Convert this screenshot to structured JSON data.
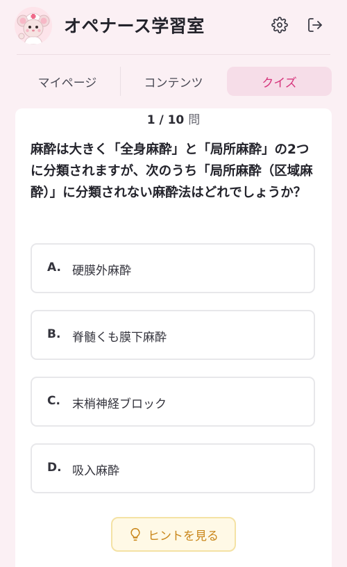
{
  "app": {
    "title": "オペナース学習室"
  },
  "header": {
    "settings_icon": "gear-icon",
    "logout_icon": "logout-icon"
  },
  "tabs": [
    {
      "label": "マイページ",
      "active": false
    },
    {
      "label": "コンテンツ",
      "active": false
    },
    {
      "label": "クイズ",
      "active": true
    }
  ],
  "quiz": {
    "counter": "1 / 10",
    "counter_unit": "問",
    "question": "麻酔は大きく「全身麻酔」と「局所麻酔」の2つに分類されますが、次のうち「局所麻酔（区域麻酔）」に分類されない麻酔法はどれでしょうか？",
    "options": [
      {
        "letter": "A.",
        "text": "硬膜外麻酔"
      },
      {
        "letter": "B.",
        "text": "脊髄くも膜下麻酔"
      },
      {
        "letter": "C.",
        "text": "末梢神経ブロック"
      },
      {
        "letter": "D.",
        "text": "吸入麻酔"
      }
    ],
    "hint_label": "ヒントを見る",
    "hint_icon": "lightbulb-icon"
  },
  "colors": {
    "background": "#fbf0f4",
    "accent": "#d6357c",
    "active_tab_bg": "#f6dde8",
    "hint_text": "#c9861a",
    "hint_bg": "#fff9e6"
  }
}
